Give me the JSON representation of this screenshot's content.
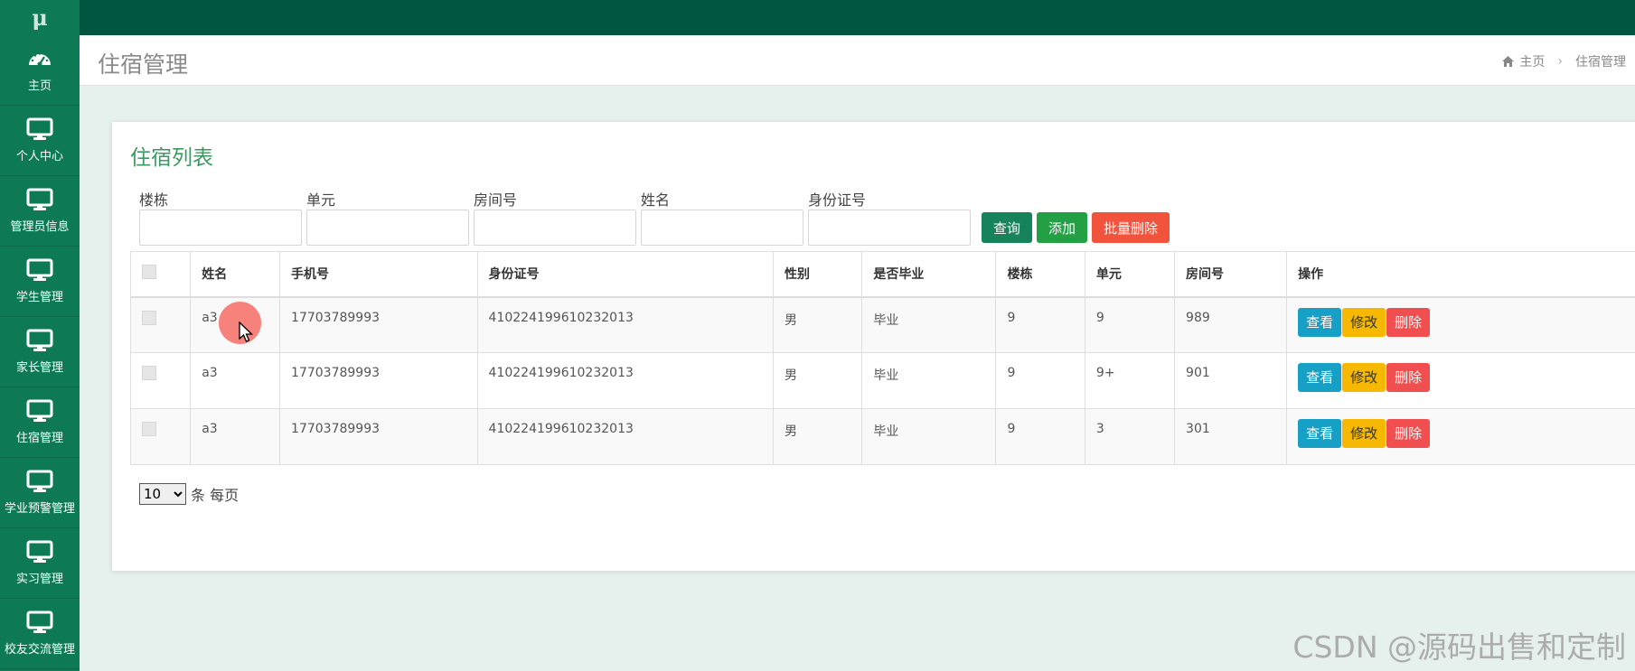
{
  "logo": "μ",
  "sidebar": {
    "items": [
      {
        "label": "主页",
        "icon": "dashboard-icon"
      },
      {
        "label": "个人中心",
        "icon": "monitor-icon"
      },
      {
        "label": "管理员信息",
        "icon": "monitor-icon"
      },
      {
        "label": "学生管理",
        "icon": "monitor-icon"
      },
      {
        "label": "家长管理",
        "icon": "monitor-icon"
      },
      {
        "label": "住宿管理",
        "icon": "monitor-icon"
      },
      {
        "label": "学业预警管理",
        "icon": "monitor-icon"
      },
      {
        "label": "实习管理",
        "icon": "monitor-icon"
      },
      {
        "label": "校友交流管理",
        "icon": "monitor-icon"
      }
    ]
  },
  "header": {
    "title": "住宿管理",
    "breadcrumb": {
      "home": "主页",
      "current": "住宿管理"
    }
  },
  "panel": {
    "title": "住宿列表",
    "search": {
      "fields": [
        {
          "label": "楼栋",
          "value": ""
        },
        {
          "label": "单元",
          "value": ""
        },
        {
          "label": "房间号",
          "value": ""
        },
        {
          "label": "姓名",
          "value": ""
        },
        {
          "label": "身份证号",
          "value": ""
        }
      ],
      "query_label": "查询",
      "add_label": "添加",
      "batch_delete_label": "批量删除"
    },
    "table": {
      "headers": [
        "姓名",
        "手机号",
        "身份证号",
        "性别",
        "是否毕业",
        "楼栋",
        "单元",
        "房间号",
        "操作"
      ],
      "rows": [
        {
          "name": "a3",
          "phone": "17703789993",
          "id_card": "410224199610232013",
          "gender": "男",
          "graduated": "毕业",
          "building": "9",
          "unit": "9",
          "room": "989"
        },
        {
          "name": "a3",
          "phone": "17703789993",
          "id_card": "410224199610232013",
          "gender": "男",
          "graduated": "毕业",
          "building": "9",
          "unit": "9+",
          "room": "901"
        },
        {
          "name": "a3",
          "phone": "17703789993",
          "id_card": "410224199610232013",
          "gender": "男",
          "graduated": "毕业",
          "building": "9",
          "unit": "3",
          "room": "301"
        }
      ],
      "actions": {
        "view": "查看",
        "edit": "修改",
        "delete": "删除"
      }
    },
    "pager": {
      "page_size": "10",
      "suffix": "条 每页"
    }
  },
  "watermark": "CSDN @源码出售和定制",
  "colors": {
    "sidebar": "#0d7a55",
    "topbar": "#005640",
    "accent_title": "#3a9a62",
    "query_button": "#16835b",
    "add_button": "#23a044",
    "batch_delete_button": "#f2533d",
    "view_button": "#17a0c6",
    "edit_button": "#f6b800",
    "delete_button": "#f14f4f"
  }
}
